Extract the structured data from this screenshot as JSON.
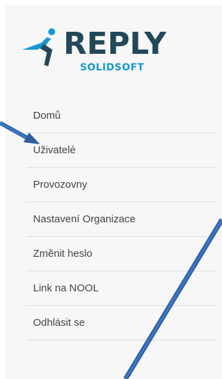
{
  "logo": {
    "brand": "REPLY",
    "subtitle": "SOLIDSOFT"
  },
  "menu": {
    "items": [
      {
        "label": "Domů"
      },
      {
        "label": "Uživatelé"
      },
      {
        "label": "Provozovny"
      },
      {
        "label": "Nastavení Organizace"
      },
      {
        "label": "Změnit heslo"
      },
      {
        "label": "Link na NOOL"
      },
      {
        "label": "Odhlásit se"
      }
    ]
  },
  "colors": {
    "brand_dark": "#22495a",
    "brand_blue": "#1798d2",
    "arrow": "#3c6fc0"
  },
  "icons": {
    "logo_mark": "running-figure-icon"
  }
}
